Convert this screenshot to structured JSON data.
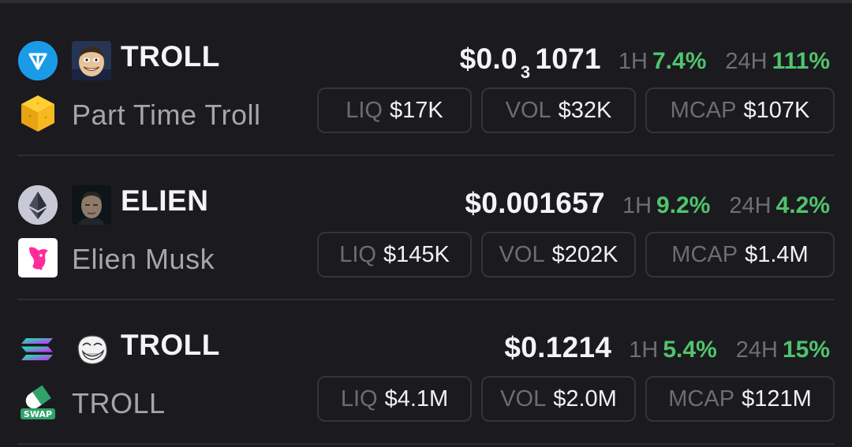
{
  "tokens": [
    {
      "chain_icon": "ton-icon",
      "avatar_icon": "troll-face-avatar",
      "dex_icon": "cube-icon",
      "symbol": "TROLL",
      "name": "Part Time Troll",
      "price_prefix": "$0.0",
      "price_sub": "3",
      "price_rest": "1071",
      "change_1h_label": "1H",
      "change_1h": "7.4%",
      "change_24h_label": "24H",
      "change_24h": "111%",
      "liq_label": "LIQ",
      "liq": "$17K",
      "vol_label": "VOL",
      "vol": "$32K",
      "mcap_label": "MCAP",
      "mcap": "$107K"
    },
    {
      "chain_icon": "ethereum-icon",
      "avatar_icon": "portrait-avatar",
      "dex_icon": "uniswap-icon",
      "symbol": "ELIEN",
      "name": "Elien Musk",
      "price": "$0.001657",
      "change_1h_label": "1H",
      "change_1h": "9.2%",
      "change_24h_label": "24H",
      "change_24h": "4.2%",
      "liq_label": "LIQ",
      "liq": "$145K",
      "vol_label": "VOL",
      "vol": "$202K",
      "mcap_label": "MCAP",
      "mcap": "$1.4M"
    },
    {
      "chain_icon": "solana-icon",
      "avatar_icon": "trollface-avatar",
      "dex_icon": "swap-pill-icon",
      "dex_icon_text": "SWAP",
      "symbol": "TROLL",
      "name": "TROLL",
      "price": "$0.1214",
      "change_1h_label": "1H",
      "change_1h": "5.4%",
      "change_24h_label": "24H",
      "change_24h": "15%",
      "liq_label": "LIQ",
      "liq": "$4.1M",
      "vol_label": "VOL",
      "vol": "$2.0M",
      "mcap_label": "MCAP",
      "mcap": "$121M"
    }
  ],
  "colors": {
    "background": "#1b1a1f",
    "positive": "#4fc46c",
    "muted": "#6f6e74",
    "pill_border": "#35343a",
    "ton_blue": "#1a9be8",
    "eth_bg": "#c8c8d6"
  }
}
